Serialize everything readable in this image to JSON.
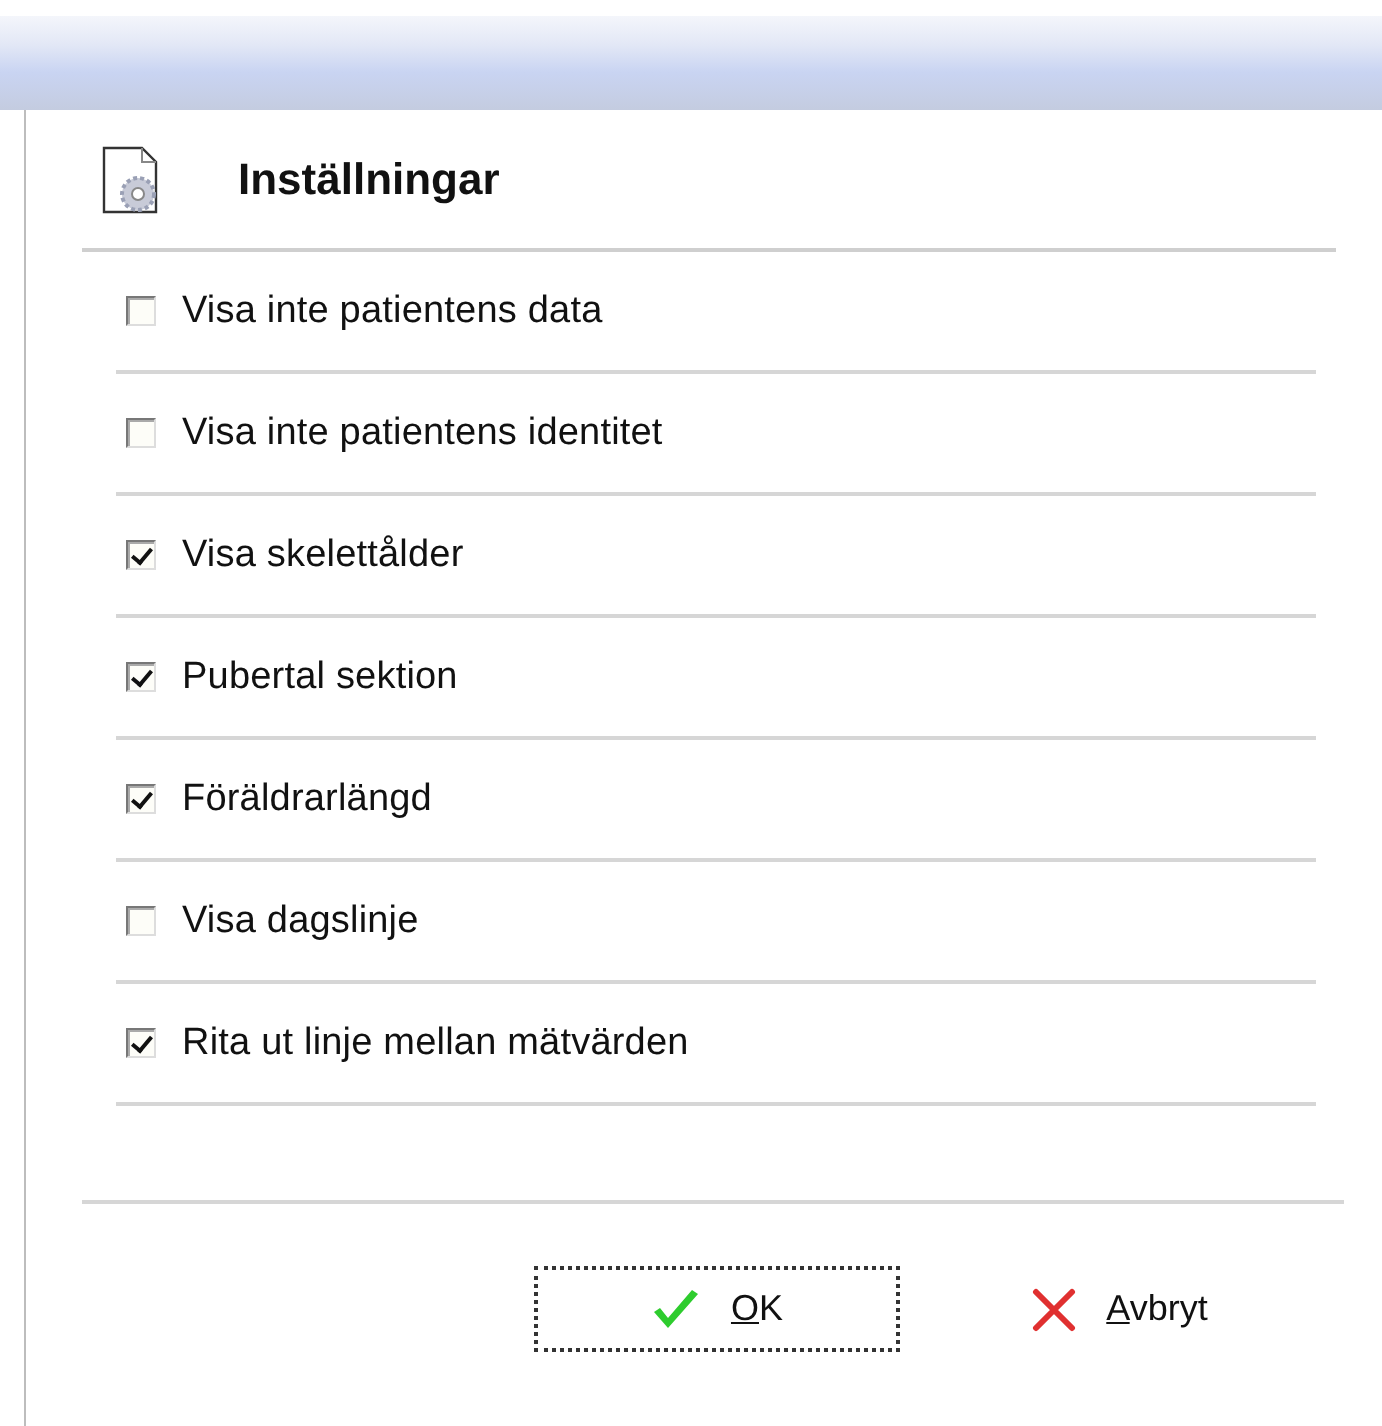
{
  "dialog": {
    "title": "Inställningar"
  },
  "options": [
    {
      "label": "Visa inte patientens data",
      "checked": false
    },
    {
      "label": "Visa inte patientens identitet",
      "checked": false
    },
    {
      "label": "Visa skelettålder",
      "checked": true
    },
    {
      "label": "Pubertal sektion",
      "checked": true
    },
    {
      "label": "Föräldrarlängd",
      "checked": true
    },
    {
      "label": "Visa dagslinje",
      "checked": false
    },
    {
      "label": "Rita ut linje mellan mätvärden",
      "checked": true
    }
  ],
  "buttons": [
    {
      "kind": "ok",
      "label": "OK",
      "focused": true
    },
    {
      "kind": "cancel",
      "label": "Avbryt",
      "focused": false
    }
  ]
}
